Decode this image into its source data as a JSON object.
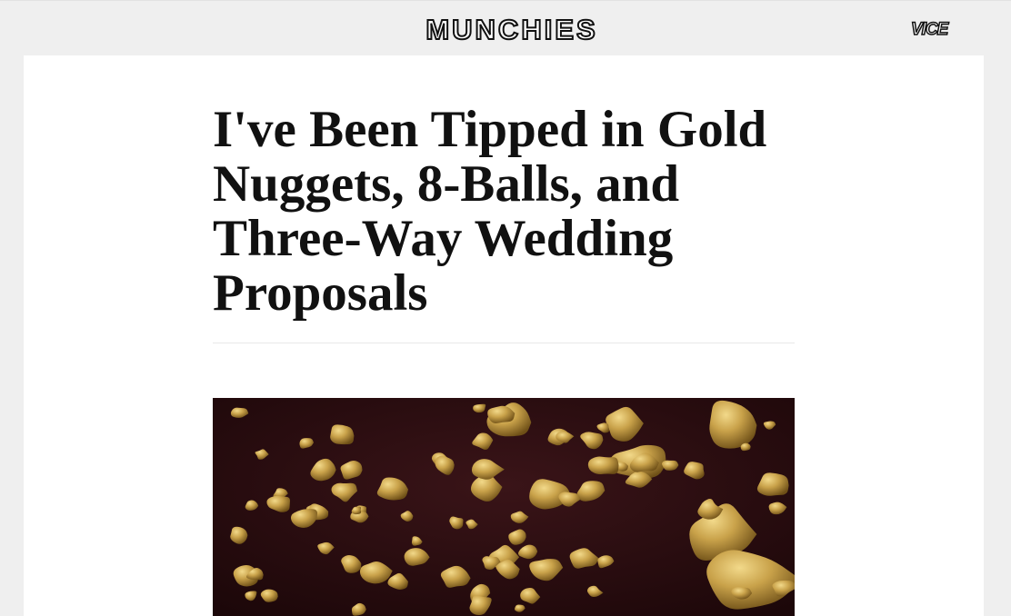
{
  "header": {
    "brand": "MUNCHIES",
    "network_logo": "VICE"
  },
  "article": {
    "headline": "I've Been Tipped in Gold Nuggets, 8-Balls, and Three-Way Wedding Proposals",
    "hero_image": {
      "subject": "gold-nuggets-photo",
      "colors": {
        "background": "#2a0d10",
        "gold": "#c9a24a",
        "gold_highlight": "#f2d98a",
        "gold_shadow": "#7a5a1c"
      }
    }
  }
}
